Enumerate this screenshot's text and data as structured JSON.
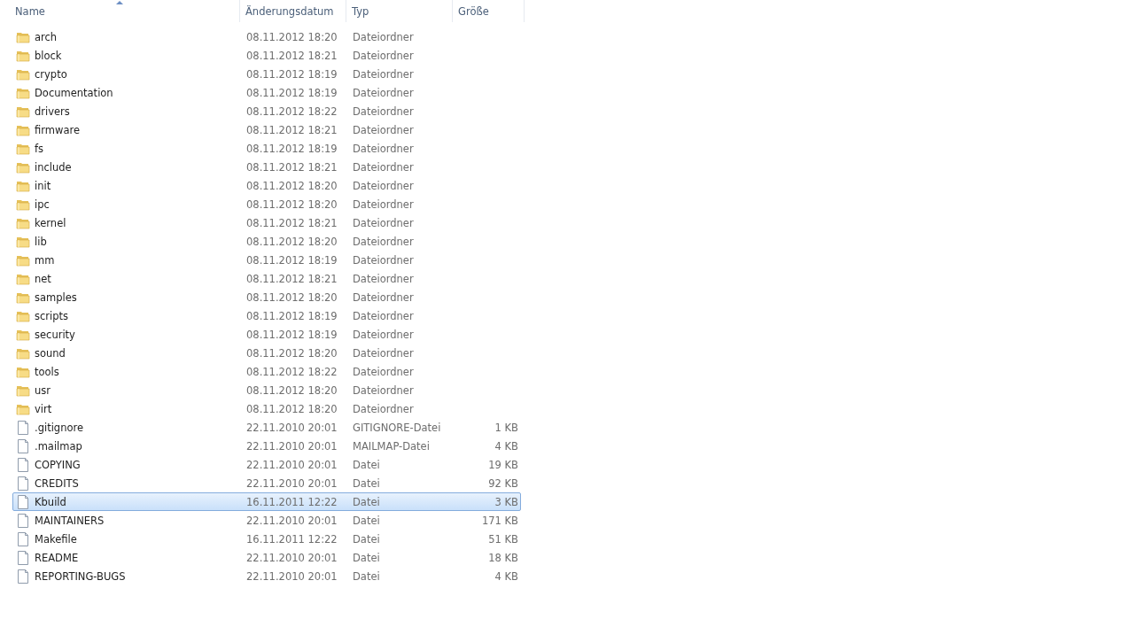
{
  "table": {
    "columns": [
      {
        "label": "Name",
        "sorted": true
      },
      {
        "label": "Änderungsdatum",
        "sorted": false
      },
      {
        "label": "Typ",
        "sorted": false
      },
      {
        "label": "Größe",
        "sorted": false
      }
    ],
    "rows": [
      {
        "kind": "folder",
        "name": "arch",
        "date": "08.11.2012 18:20",
        "type": "Dateiordner",
        "selected": false
      },
      {
        "kind": "folder",
        "name": "block",
        "date": "08.11.2012 18:21",
        "type": "Dateiordner",
        "selected": false
      },
      {
        "kind": "folder",
        "name": "crypto",
        "date": "08.11.2012 18:19",
        "type": "Dateiordner",
        "selected": false
      },
      {
        "kind": "folder",
        "name": "Documentation",
        "date": "08.11.2012 18:19",
        "type": "Dateiordner",
        "selected": false
      },
      {
        "kind": "folder",
        "name": "drivers",
        "date": "08.11.2012 18:22",
        "type": "Dateiordner",
        "selected": false
      },
      {
        "kind": "folder",
        "name": "firmware",
        "date": "08.11.2012 18:21",
        "type": "Dateiordner",
        "selected": false
      },
      {
        "kind": "folder",
        "name": "fs",
        "date": "08.11.2012 18:19",
        "type": "Dateiordner",
        "selected": false
      },
      {
        "kind": "folder",
        "name": "include",
        "date": "08.11.2012 18:21",
        "type": "Dateiordner",
        "selected": false
      },
      {
        "kind": "folder",
        "name": "init",
        "date": "08.11.2012 18:20",
        "type": "Dateiordner",
        "selected": false
      },
      {
        "kind": "folder",
        "name": "ipc",
        "date": "08.11.2012 18:20",
        "type": "Dateiordner",
        "selected": false
      },
      {
        "kind": "folder",
        "name": "kernel",
        "date": "08.11.2012 18:21",
        "type": "Dateiordner",
        "selected": false
      },
      {
        "kind": "folder",
        "name": "lib",
        "date": "08.11.2012 18:20",
        "type": "Dateiordner",
        "selected": false
      },
      {
        "kind": "folder",
        "name": "mm",
        "date": "08.11.2012 18:19",
        "type": "Dateiordner",
        "selected": false
      },
      {
        "kind": "folder",
        "name": "net",
        "date": "08.11.2012 18:21",
        "type": "Dateiordner",
        "selected": false
      },
      {
        "kind": "folder",
        "name": "samples",
        "date": "08.11.2012 18:20",
        "type": "Dateiordner",
        "selected": false
      },
      {
        "kind": "folder",
        "name": "scripts",
        "date": "08.11.2012 18:19",
        "type": "Dateiordner",
        "selected": false
      },
      {
        "kind": "folder",
        "name": "security",
        "date": "08.11.2012 18:19",
        "type": "Dateiordner",
        "selected": false
      },
      {
        "kind": "folder",
        "name": "sound",
        "date": "08.11.2012 18:20",
        "type": "Dateiordner",
        "selected": false
      },
      {
        "kind": "folder",
        "name": "tools",
        "date": "08.11.2012 18:22",
        "type": "Dateiordner",
        "selected": false
      },
      {
        "kind": "folder",
        "name": "usr",
        "date": "08.11.2012 18:20",
        "type": "Dateiordner",
        "selected": false
      },
      {
        "kind": "folder",
        "name": "virt",
        "date": "08.11.2012 18:20",
        "type": "Dateiordner",
        "selected": false
      },
      {
        "kind": "file",
        "name": ".gitignore",
        "date": "22.11.2010 20:01",
        "type": "GITIGNORE-Datei",
        "size": "1 KB",
        "selected": false
      },
      {
        "kind": "file",
        "name": ".mailmap",
        "date": "22.11.2010 20:01",
        "type": "MAILMAP-Datei",
        "size": "4 KB",
        "selected": false
      },
      {
        "kind": "file",
        "name": "COPYING",
        "date": "22.11.2010 20:01",
        "type": "Datei",
        "size": "19 KB",
        "selected": false
      },
      {
        "kind": "file",
        "name": "CREDITS",
        "date": "22.11.2010 20:01",
        "type": "Datei",
        "size": "92 KB",
        "selected": false
      },
      {
        "kind": "file",
        "name": "Kbuild",
        "date": "16.11.2011 12:22",
        "type": "Datei",
        "size": "3 KB",
        "selected": true
      },
      {
        "kind": "file",
        "name": "MAINTAINERS",
        "date": "22.11.2010 20:01",
        "type": "Datei",
        "size": "171 KB",
        "selected": false
      },
      {
        "kind": "file",
        "name": "Makefile",
        "date": "16.11.2011 12:22",
        "type": "Datei",
        "size": "51 KB",
        "selected": false
      },
      {
        "kind": "file",
        "name": "README",
        "date": "22.11.2010 20:01",
        "type": "Datei",
        "size": "18 KB",
        "selected": false
      },
      {
        "kind": "file",
        "name": "REPORTING-BUGS",
        "date": "22.11.2010 20:01",
        "type": "Datei",
        "size": "4 KB",
        "selected": false
      }
    ]
  }
}
